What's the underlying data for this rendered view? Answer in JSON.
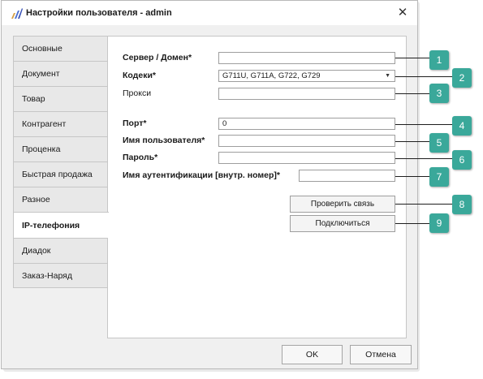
{
  "window": {
    "title": "Настройки пользователя - admin",
    "close_glyph": "✕",
    "accent": "#3aa89a"
  },
  "sidebar": {
    "items": [
      {
        "label": "Основные"
      },
      {
        "label": "Документ"
      },
      {
        "label": "Товар"
      },
      {
        "label": "Контрагент"
      },
      {
        "label": "Проценка"
      },
      {
        "label": "Быстрая продажа"
      },
      {
        "label": "Разное"
      },
      {
        "label": "IP-телефония",
        "active": true
      },
      {
        "label": "Диадок"
      },
      {
        "label": "Заказ-Наряд"
      }
    ]
  },
  "form": {
    "server": {
      "label": "Сервер / Домен*",
      "value": ""
    },
    "codecs": {
      "label": "Кодеки*",
      "value": "G711U, G711A, G722, G729"
    },
    "proxy": {
      "label": "Прокси",
      "value": ""
    },
    "port": {
      "label": "Порт*",
      "value": "0"
    },
    "username": {
      "label": "Имя пользователя*",
      "value": ""
    },
    "password": {
      "label": "Пароль*",
      "value": ""
    },
    "auth_name": {
      "label": "Имя аутентификации [внутр. номер]*",
      "value": ""
    },
    "check_button": "Проверить связь",
    "connect_button": "Подключиться"
  },
  "footer": {
    "ok": "OK",
    "cancel": "Отмена"
  },
  "callouts": [
    "1",
    "2",
    "3",
    "4",
    "5",
    "6",
    "7",
    "8",
    "9"
  ]
}
